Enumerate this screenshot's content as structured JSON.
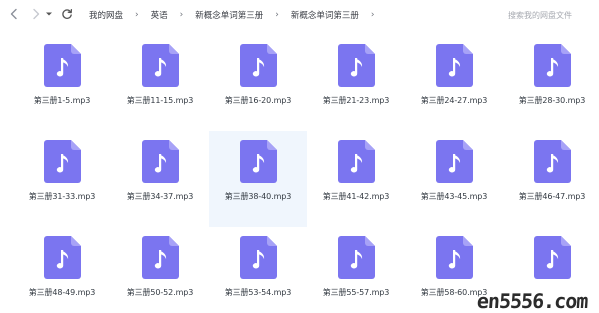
{
  "toolbar": {
    "back_icon": "chevron-left-icon",
    "forward_icon": "chevron-right-icon",
    "dropdown_icon": "caret-down-icon",
    "refresh_icon": "refresh-icon"
  },
  "breadcrumb": [
    "我的网盘",
    "英语",
    "新概念单词第三册",
    "新概念单词第三册"
  ],
  "search": {
    "placeholder": "搜索我的网盘文件"
  },
  "colors": {
    "file_icon": "#7b75f0",
    "file_fold": "#a7a2f7",
    "selected_bg": "#f0f6fd"
  },
  "files": [
    {
      "name": "第三册1-5.mp3",
      "icon": "audio-file-icon"
    },
    {
      "name": "第三册11-15.mp3",
      "icon": "audio-file-icon"
    },
    {
      "name": "第三册16-20.mp3",
      "icon": "audio-file-icon"
    },
    {
      "name": "第三册21-23.mp3",
      "icon": "audio-file-icon"
    },
    {
      "name": "第三册24-27.mp3",
      "icon": "audio-file-icon"
    },
    {
      "name": "第三册28-30.mp3",
      "icon": "audio-file-icon"
    },
    {
      "name": "第三册31-33.mp3",
      "icon": "audio-file-icon"
    },
    {
      "name": "第三册34-37.mp3",
      "icon": "audio-file-icon"
    },
    {
      "name": "第三册38-40.mp3",
      "icon": "audio-file-icon",
      "selected": true
    },
    {
      "name": "第三册41-42.mp3",
      "icon": "audio-file-icon"
    },
    {
      "name": "第三册43-45.mp3",
      "icon": "audio-file-icon"
    },
    {
      "name": "第三册46-47.mp3",
      "icon": "audio-file-icon"
    },
    {
      "name": "第三册48-49.mp3",
      "icon": "audio-file-icon"
    },
    {
      "name": "第三册50-52.mp3",
      "icon": "audio-file-icon"
    },
    {
      "name": "第三册53-54.mp3",
      "icon": "audio-file-icon"
    },
    {
      "name": "第三册55-57.mp3",
      "icon": "audio-file-icon"
    },
    {
      "name": "第三册58-60.mp3",
      "icon": "audio-file-icon"
    },
    {
      "name": "",
      "icon": "audio-file-icon"
    }
  ],
  "watermark": "en5556.com"
}
